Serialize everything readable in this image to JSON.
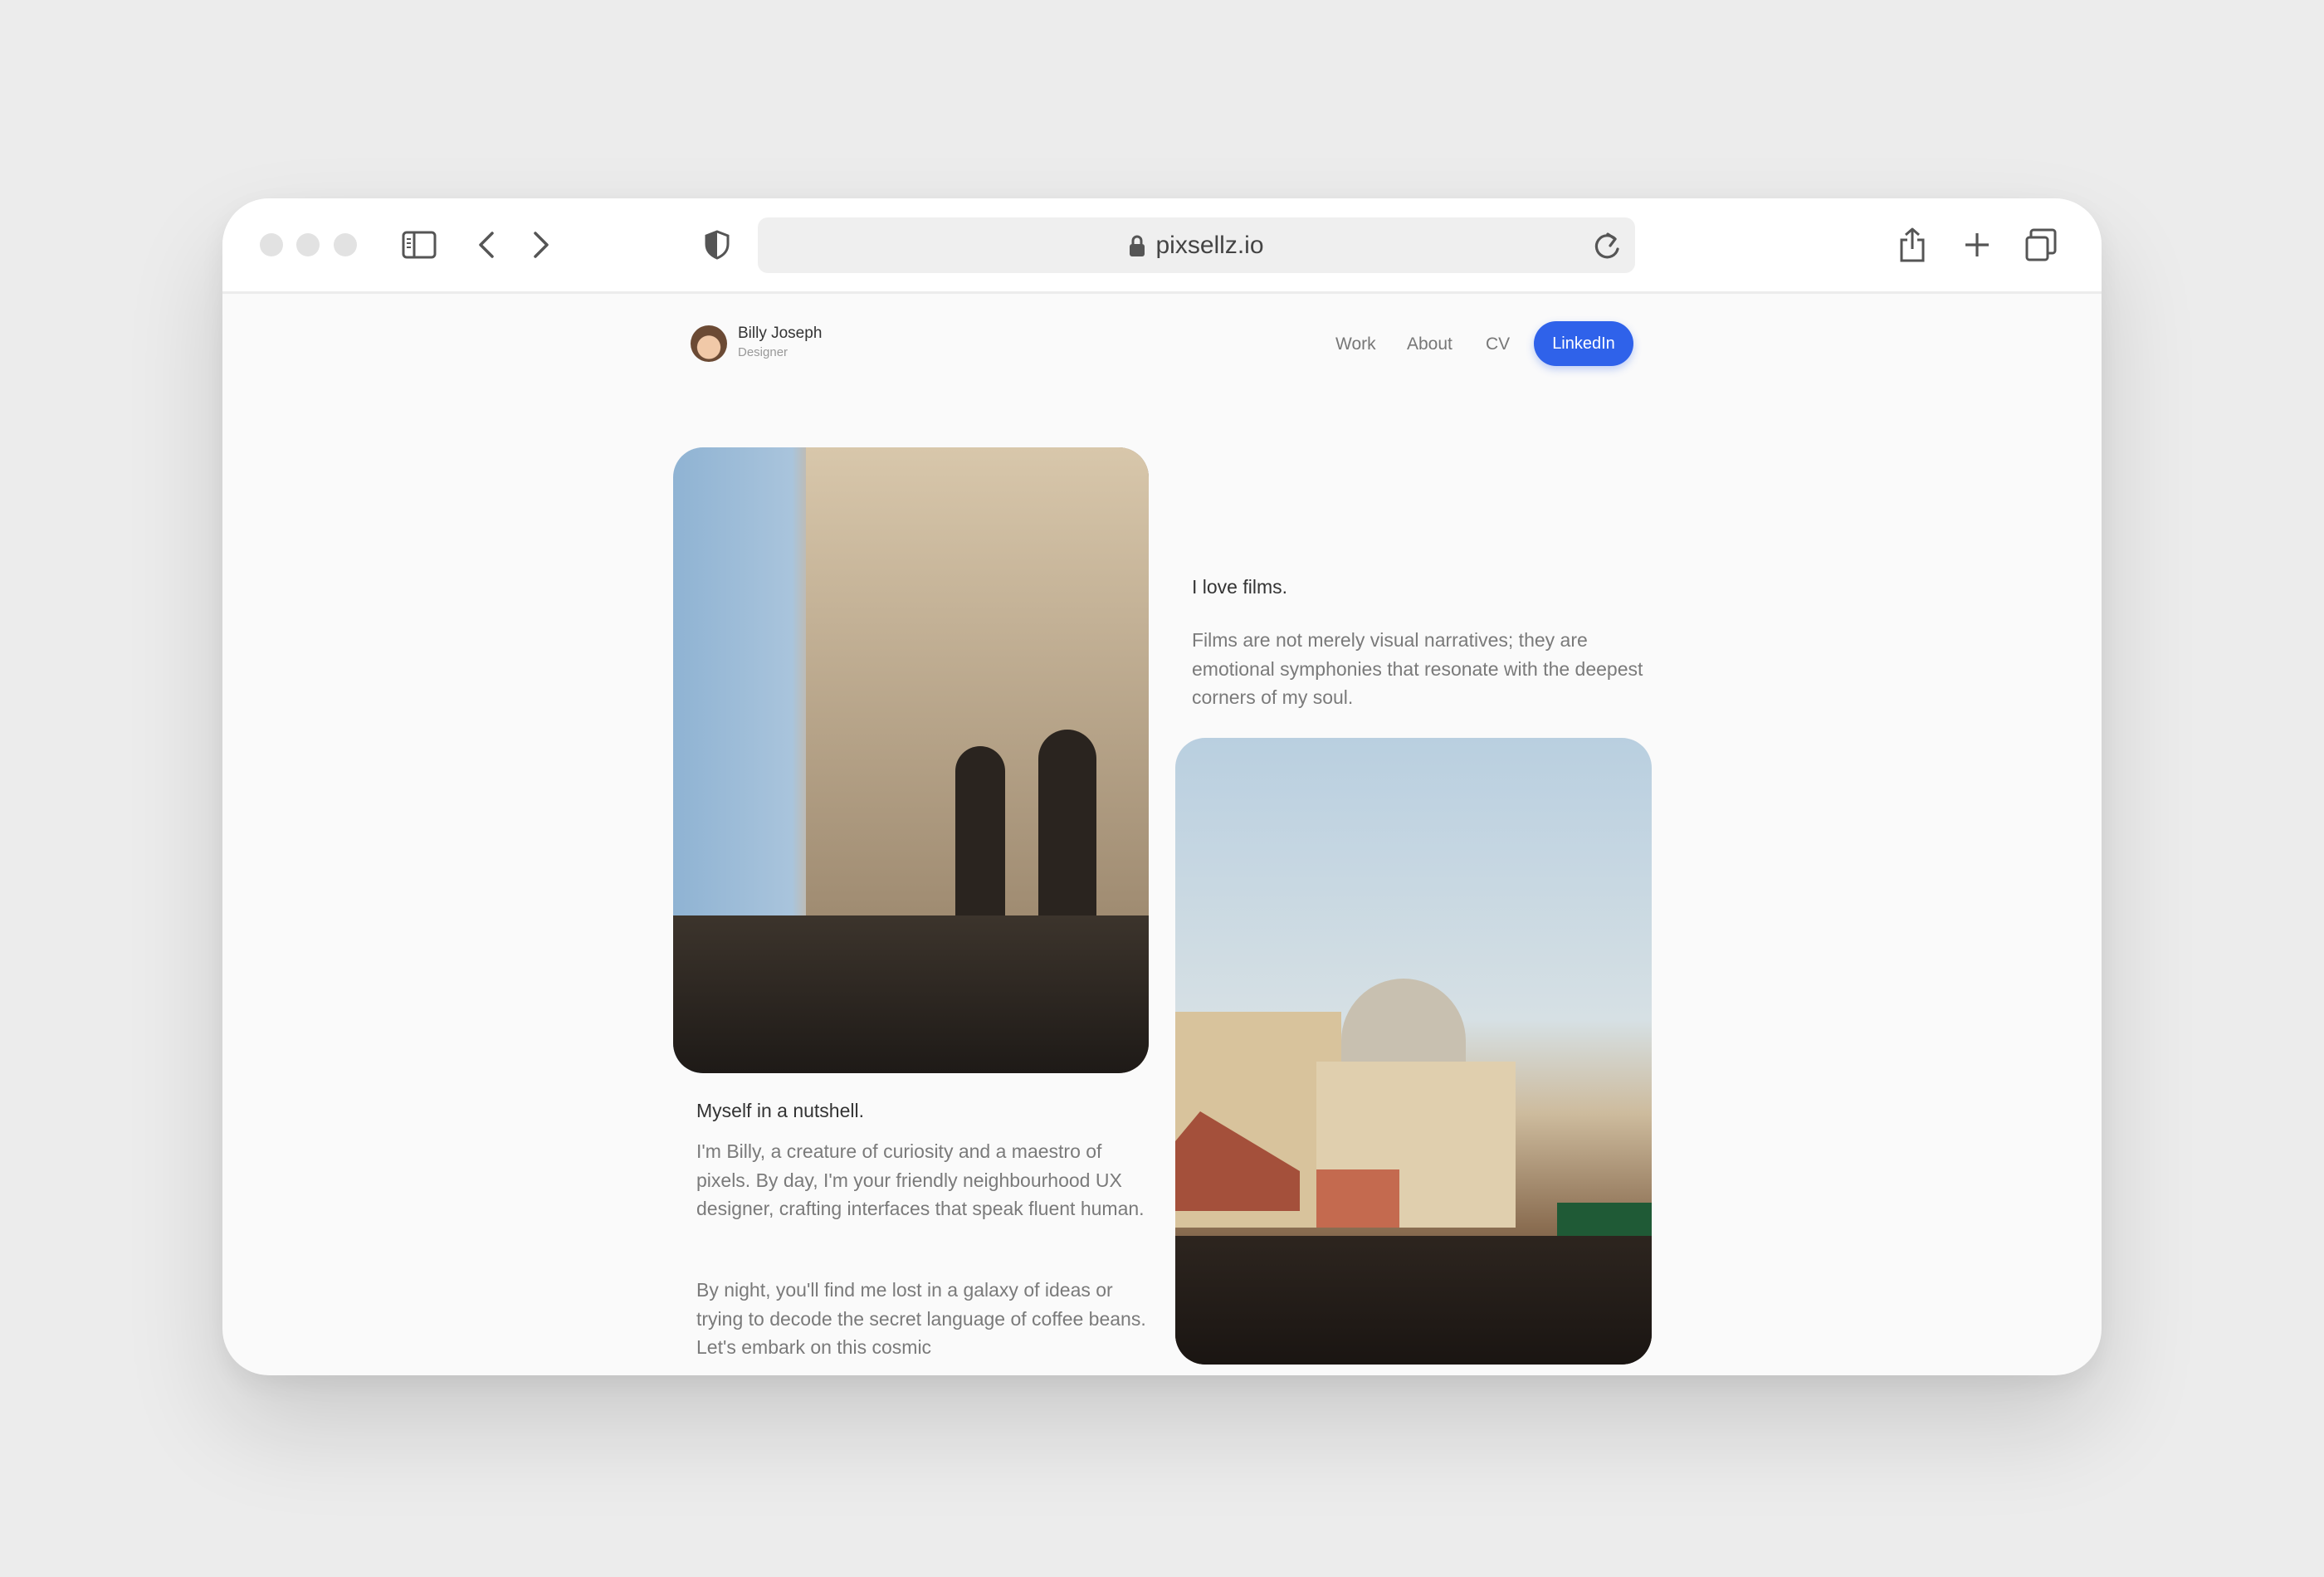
{
  "browser": {
    "url": "pixsellz.io",
    "icons": [
      "sidebar-icon",
      "back-icon",
      "forward-icon",
      "shield-icon",
      "lock-icon",
      "reload-icon",
      "share-icon",
      "new-tab-icon",
      "tabs-icon"
    ]
  },
  "header": {
    "name": "Billy Joseph",
    "role": "Designer",
    "nav": [
      "Work",
      "About",
      "CV"
    ],
    "cta": "LinkedIn",
    "accent": "#2f62ea"
  },
  "films": {
    "title": "I love films.",
    "body": "Films are not merely visual narratives; they are emotional symphonies that resonate with the deepest corners of my soul."
  },
  "about": {
    "title": "Myself in a nutshell.",
    "p1": "I'm Billy, a creature of curiosity and a maestro of pixels. By day, I'm your friendly neighbourhood UX designer, crafting interfaces that speak fluent human.",
    "p2": "By night, you'll find me lost in a galaxy of ideas or trying to decode the secret language of coffee beans. Let's embark on this cosmic"
  }
}
